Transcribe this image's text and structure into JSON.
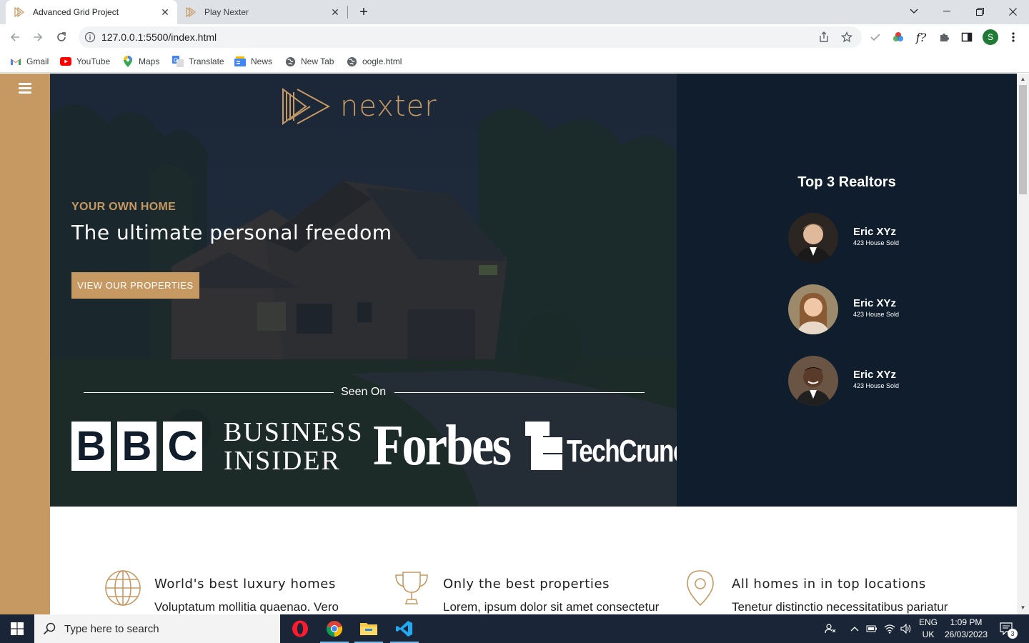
{
  "browser": {
    "tabs": [
      {
        "title": "Advanced Grid Project",
        "active": true
      },
      {
        "title": "Play Nexter",
        "active": false
      }
    ],
    "url": "127.0.0.1:5500/index.html",
    "profile_initial": "S",
    "bookmarks": [
      "Gmail",
      "YouTube",
      "Maps",
      "Translate",
      "News",
      "New Tab",
      "oogle.html"
    ]
  },
  "hero": {
    "logo_text": "nexter",
    "eyebrow": "YOUR OWN HOME",
    "title": "The ultimate personal freedom",
    "button_label": "VIEW OUR PROPERTIES",
    "seen_on_label": "Seen On",
    "brands": {
      "bbc": [
        "B",
        "B",
        "C"
      ],
      "business_insider_line1": "BUSINESS",
      "business_insider_line2": "INSIDER",
      "forbes": "Forbes",
      "techcrunch": "TechCrunch"
    }
  },
  "realtors": {
    "heading": "Top 3 Realtors",
    "items": [
      {
        "name": "Eric XYz",
        "sold": "423 House Sold"
      },
      {
        "name": "Eric XYz",
        "sold": "423 House Sold"
      },
      {
        "name": "Eric XYz",
        "sold": "423 House Sold"
      }
    ]
  },
  "features": [
    {
      "title": "World's best luxury homes",
      "text": "Voluptatum mollitia quaenao. Vero",
      "icon": "globe-icon"
    },
    {
      "title": "Only the best properties",
      "text": "Lorem, ipsum dolor sit amet consectetur",
      "icon": "trophy-icon"
    },
    {
      "title": "All homes in in top locations",
      "text": "Tenetur distinctio necessitatibus pariatur",
      "icon": "map-pin-icon"
    }
  ],
  "taskbar": {
    "search_placeholder": "Type here to search",
    "lang_line1": "ENG",
    "lang_line2": "UK",
    "time": "1:09 PM",
    "date": "26/03/2023",
    "notification_count": "3"
  },
  "colors": {
    "accent": "#c69963",
    "navy": "#101d2c",
    "taskbar": "#1a2637"
  }
}
